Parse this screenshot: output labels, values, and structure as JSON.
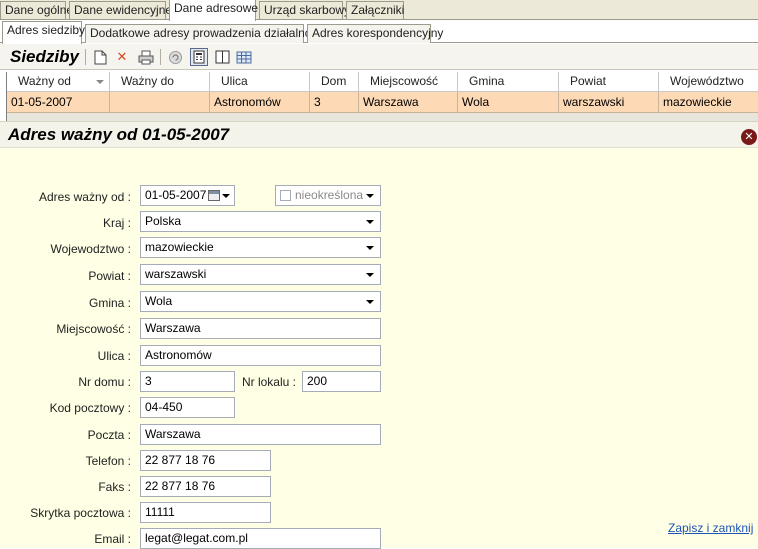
{
  "tabs_top": [
    "Dane ogólne",
    "Dane ewidencyjne",
    "Dane adresowe",
    "Urząd skarbowy",
    "Załączniki"
  ],
  "tabs_sub": [
    "Adres siedziby",
    "Dodatkowe adresy prowadzenia działalności",
    "Adres korespondencyjny"
  ],
  "toolbar": {
    "title": "Siedziby"
  },
  "grid": {
    "columns": [
      "Ważny od",
      "Ważny do",
      "Ulica",
      "Dom",
      "Miejscowość",
      "Gmina",
      "Powiat",
      "Województwo"
    ],
    "rows": [
      [
        "01-05-2007",
        "",
        "Astronomów",
        "3",
        "Warszawa",
        "Wola",
        "warszawski",
        "mazowieckie"
      ]
    ]
  },
  "detail": {
    "title": "Adres ważny od 01-05-2007",
    "labels": {
      "valid_from": "Adres ważny od :",
      "country": "Kraj :",
      "voivodeship": "Wojewodztwo :",
      "county": "Powiat :",
      "commune": "Gmina :",
      "city": "Miejscowość :",
      "street": "Ulica :",
      "house": "Nr domu :",
      "apartment": "Nr lokalu :",
      "postal_code": "Kod pocztowy :",
      "post_office": "Poczta :",
      "phone": "Telefon :",
      "fax": "Faks :",
      "po_box": "Skrytka pocztowa :",
      "email": "Email :"
    },
    "values": {
      "valid_from": "01-05-2007",
      "valid_to": "nieokreślona",
      "country": "Polska",
      "voivodeship": "mazowieckie",
      "county": "warszawski",
      "commune": "Wola",
      "city": "Warszawa",
      "street": "Astronomów",
      "house": "3",
      "apartment": "200",
      "postal_code": "04-450",
      "post_office": "Warszawa",
      "phone": "22 877 18 76",
      "fax": "22 877 18 76",
      "po_box": "11111",
      "email": "legat@legat.com.pl"
    },
    "save_link": "Zapisz i zamknij"
  }
}
